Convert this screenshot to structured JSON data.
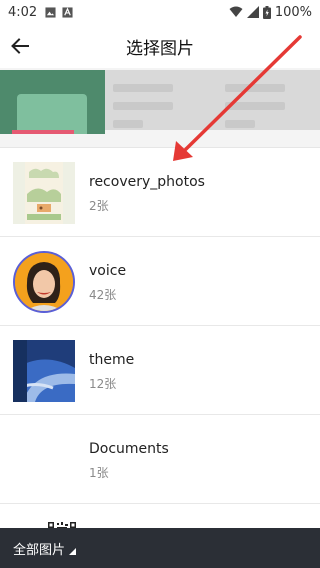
{
  "status": {
    "time": "4:02",
    "battery": "100%"
  },
  "appbar": {
    "title": "选择图片"
  },
  "albums": [
    {
      "name": "recovery_photos",
      "count": "2张"
    },
    {
      "name": "voice",
      "count": "42张"
    },
    {
      "name": "theme",
      "count": "12张"
    },
    {
      "name": "Documents",
      "count": "1张"
    }
  ],
  "bottom": {
    "label": "全部图片"
  },
  "colors": {
    "accent_arrow": "#e53935",
    "bottom_bar": "#2b2f36"
  }
}
